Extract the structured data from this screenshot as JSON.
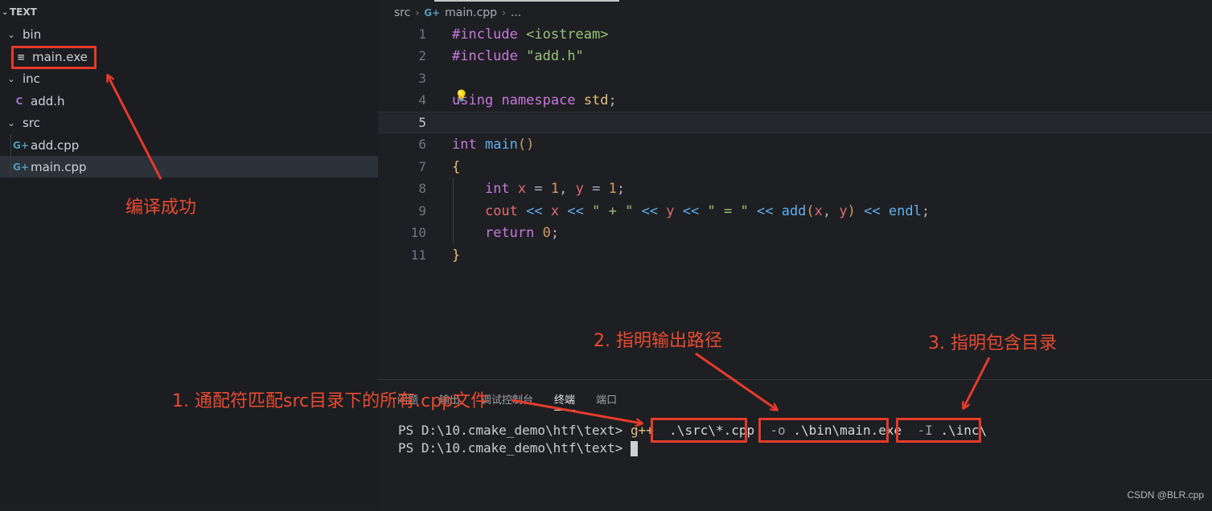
{
  "explorer": {
    "root_label": "TEXT",
    "items": [
      {
        "label": "bin",
        "kind": "folder"
      },
      {
        "label": "main.exe",
        "kind": "file",
        "icon": "exe-file-icon"
      },
      {
        "label": "inc",
        "kind": "folder"
      },
      {
        "label": "add.h",
        "kind": "file",
        "icon": "c-header-icon",
        "glyph": "C"
      },
      {
        "label": "src",
        "kind": "folder"
      },
      {
        "label": "add.cpp",
        "kind": "file",
        "icon": "cpp-file-icon",
        "glyph": "G+"
      },
      {
        "label": "main.cpp",
        "kind": "file",
        "icon": "cpp-file-icon",
        "glyph": "G+",
        "selected": true
      }
    ]
  },
  "breadcrumb": {
    "folder": "src",
    "file": "main.cpp",
    "more": "..."
  },
  "editor": {
    "active_line": 5,
    "line_numbers": [
      "1",
      "2",
      "3",
      "4",
      "5",
      "6",
      "7",
      "8",
      "9",
      "10",
      "11"
    ]
  },
  "panel": {
    "tabs": [
      "问题",
      "输出",
      "调试控制台",
      "终端",
      "端口"
    ],
    "active_tab": "终端",
    "terminal": {
      "prompt": "PS D:\\10.cmake_demo\\htf\\text>",
      "command": "g++",
      "arg_src": ".\\src\\*.cpp",
      "arg_out_flag": "-o",
      "arg_out": ".\\bin\\main.exe",
      "arg_inc_flag": "-I",
      "arg_inc": ".\\inc\\"
    }
  },
  "annotations": {
    "build_success": "编译成功",
    "wildcard": "1. 通配符匹配src目录下的所有.cpp文件",
    "output_path": "2. 指明输出路径",
    "include_dir": "3. 指明包含目录",
    "color": "#e53b2b"
  },
  "watermark": "CSDN @BLR.cpp"
}
